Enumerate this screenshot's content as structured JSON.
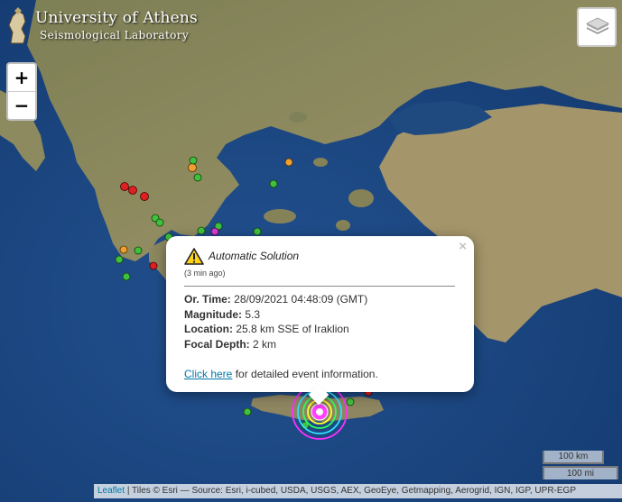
{
  "logo": {
    "title": "University of Athens",
    "subtitle": "Seismological Laboratory"
  },
  "zoom": {
    "in_label": "+",
    "out_label": "−"
  },
  "layers_icon": "layers-icon",
  "popup": {
    "close_label": "×",
    "title": "Automatic Solution",
    "age": "(3 min ago)",
    "fields": [
      {
        "label": "Or. Time:",
        "value": "28/09/2021 04:48:09 (GMT)"
      },
      {
        "label": "Magnitude:",
        "value": "5.3"
      },
      {
        "label": "Location:",
        "value": "25.8 km SSE of Iraklion"
      },
      {
        "label": "Focal Depth:",
        "value": "2 km"
      }
    ],
    "link_text": "Click here",
    "link_suffix": "for detailed event information."
  },
  "scale": {
    "km": "100 km",
    "mi": "100 mi"
  },
  "attribution": {
    "leaflet": "Leaflet",
    "rest": "| Tiles © Esri — Source: Esri, i-cubed, USDA, USGS, AEX, GeoEye, Getmapping, Aerogrid, IGN, IGP, UPR-EGP"
  },
  "colors": {
    "sea": "#1d4a86",
    "land": "#8a8a5a",
    "popup_link": "#0078a8"
  }
}
